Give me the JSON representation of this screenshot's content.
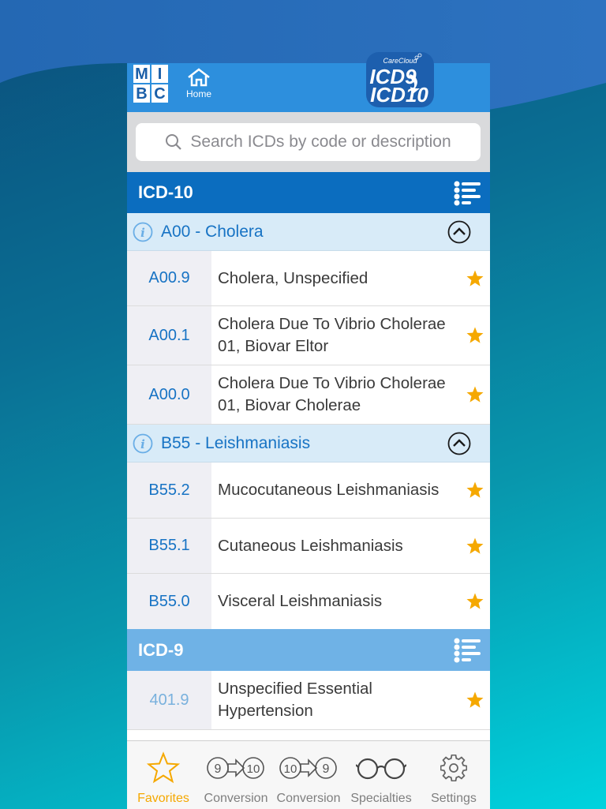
{
  "app": {
    "logo_text": [
      "M",
      "I",
      "B",
      "C"
    ],
    "brand_logo_text": "CareCloud ICD9 ICD10"
  },
  "nav": {
    "home_label": "Home"
  },
  "search": {
    "placeholder": "Search ICDs by code or description"
  },
  "sections": [
    {
      "title": "ICD-10",
      "groups": [
        {
          "title": "A00 - Cholera",
          "rows": [
            {
              "code": "A00.9",
              "desc_lines": [
                "Cholera, Unspecified"
              ]
            },
            {
              "code": "A00.1",
              "desc_lines": [
                "Cholera Due To Vibrio Cholerae",
                "01, Biovar Eltor"
              ]
            },
            {
              "code": "A00.0",
              "desc_lines": [
                "Cholera Due To Vibrio Cholerae",
                "01, Biovar Cholerae"
              ]
            }
          ]
        },
        {
          "title": "B55 - Leishmaniasis",
          "rows": [
            {
              "code": "B55.2",
              "desc_lines": [
                "Mucocutaneous Leishmaniasis"
              ]
            },
            {
              "code": "B55.1",
              "desc_lines": [
                "Cutaneous Leishmaniasis"
              ]
            },
            {
              "code": "B55.0",
              "desc_lines": [
                "Visceral Leishmaniasis"
              ]
            }
          ]
        }
      ]
    },
    {
      "title": "ICD-9",
      "rows": [
        {
          "code": "401.9",
          "desc_lines": [
            "Unspecified Essential",
            "Hypertension"
          ]
        }
      ]
    }
  ],
  "tabs": [
    {
      "label": "Favorites",
      "icon": "star-outline-icon",
      "active": true
    },
    {
      "label": "Conversion",
      "icon": "icd9-to-icd10-icon",
      "from": "9",
      "to": "10"
    },
    {
      "label": "Conversion",
      "icon": "icd10-to-icd9-icon",
      "from": "10",
      "to": "9"
    },
    {
      "label": "Specialties",
      "icon": "glasses-icon"
    },
    {
      "label": "Settings",
      "icon": "gear-icon"
    }
  ],
  "colors": {
    "accent": "#0b6dbf",
    "nav_bar": "#2d8fdd",
    "icd9_header": "#6fb2e6",
    "group_header": "#d8ebf8",
    "code_text": "#1773c4",
    "star": "#f5a800",
    "background_gradient": [
      "#0b4f7c",
      "#00d3de"
    ]
  }
}
